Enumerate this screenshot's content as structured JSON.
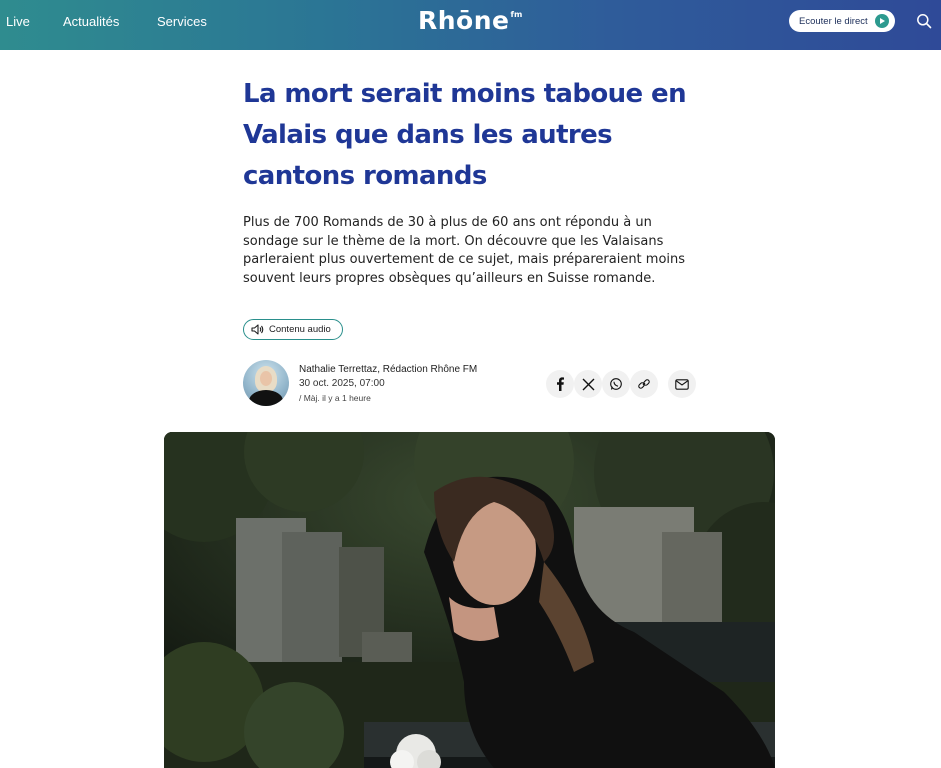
{
  "header": {
    "nav": [
      "Live",
      "Actualités",
      "Services"
    ],
    "logo_text": "Rhōne",
    "logo_suffix": "fm",
    "live_button": "Ecouter le direct",
    "search_icon": "search-icon",
    "colors": {
      "gradient_start": "#2f8c8f",
      "gradient_end": "#2f4a98",
      "play": "#2d9a8f"
    }
  },
  "article": {
    "title": "La mort serait moins taboue en Valais que dans les autres cantons romands",
    "lead": "Plus de 700 Romands de 30 à plus de 60 ans ont répondu à un sondage sur le thème de la mort. On découvre que les Valaisans parleraient plus ouvertement de ce sujet, mais prépareraient moins souvent leurs propres obsèques qu’ailleurs en Suisse romande.",
    "audio_tag": "Contenu audio",
    "author": "Nathalie Terrettaz, Rédaction Rhône FM",
    "date": "30 oct. 2025, 07:00",
    "updated": "/ Màj. il y a 1 heure",
    "title_color": "#1f3796"
  },
  "share": [
    {
      "icon": "facebook-icon"
    },
    {
      "icon": "x-icon"
    },
    {
      "icon": "whatsapp-icon"
    },
    {
      "icon": "link-icon"
    },
    {
      "icon": "mail-icon"
    }
  ]
}
